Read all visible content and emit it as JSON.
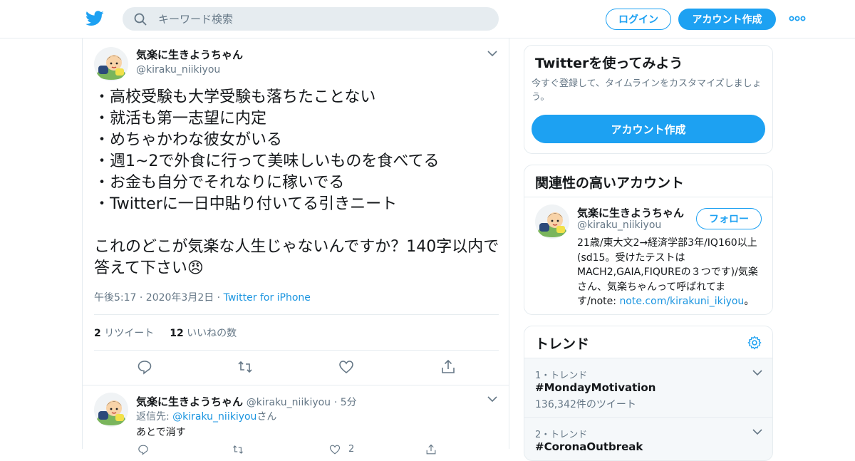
{
  "header": {
    "search_placeholder": "キーワード検索",
    "login": "ログイン",
    "signup": "アカウント作成"
  },
  "tweet": {
    "name": "気楽に生きようちゃん",
    "handle": "@kiraku_niikiyou",
    "lines": [
      "・高校受験も大学受験も落ちたことない",
      "・就活も第一志望に内定",
      "・めちゃかわな彼女がいる",
      "・週1~2で外食に行って美味しいものを食べてる",
      "・お金も自分でそれなりに稼いでる",
      "・Twitterに一日中貼り付いてる引きニート"
    ],
    "closing": "これのどこが気楽な人生じゃないんですか？140字以内で答えて下さい😠",
    "timestamp": "午後5:17 · 2020年3月2日 · ",
    "source": "Twitter for iPhone",
    "retweet_count": "2",
    "retweet_label": "リツイート",
    "like_count": "12",
    "like_label": "いいねの数"
  },
  "reply": {
    "name": "気楽に生きようちゃん",
    "handle": "@kiraku_niikiyou",
    "time": "· 5分",
    "reply_to_prefix": "返信先: ",
    "reply_to_handle": "@kiraku_niikiyou",
    "reply_to_suffix": "さん",
    "text": "あとで消す",
    "like_count": "2"
  },
  "sidebar": {
    "try_title": "Twitterを使ってみよう",
    "try_sub": "今すぐ登録して、タイムラインをカスタマイズしましょう。",
    "try_cta": "アカウント作成",
    "related_title": "関連性の高いアカウント",
    "related_name": "気楽に生きようちゃん",
    "related_handle": "@kiraku_niikiyou",
    "follow": "フォロー",
    "bio": "21歳/東大文2→経済学部3年/IQ160以上(sd15。受けたテストはMACH2,GAIA,FIQUREの３つです)/気楽さん、気楽ちゃんって呼ばれてます/note: ",
    "bio_link": "note.com/kirakuni_ikiyou",
    "bio_end": "。",
    "trends_title": "トレンド",
    "trends": [
      {
        "rank": "1・トレンド",
        "tag": "#MondayMotivation",
        "count": "136,342件のツイート"
      },
      {
        "rank": "2・トレンド",
        "tag": "#CoronaOutbreak",
        "count": ""
      }
    ]
  },
  "colors": {
    "accent": "#1da1f2",
    "link": "#1b95e0",
    "muted": "#657786"
  }
}
